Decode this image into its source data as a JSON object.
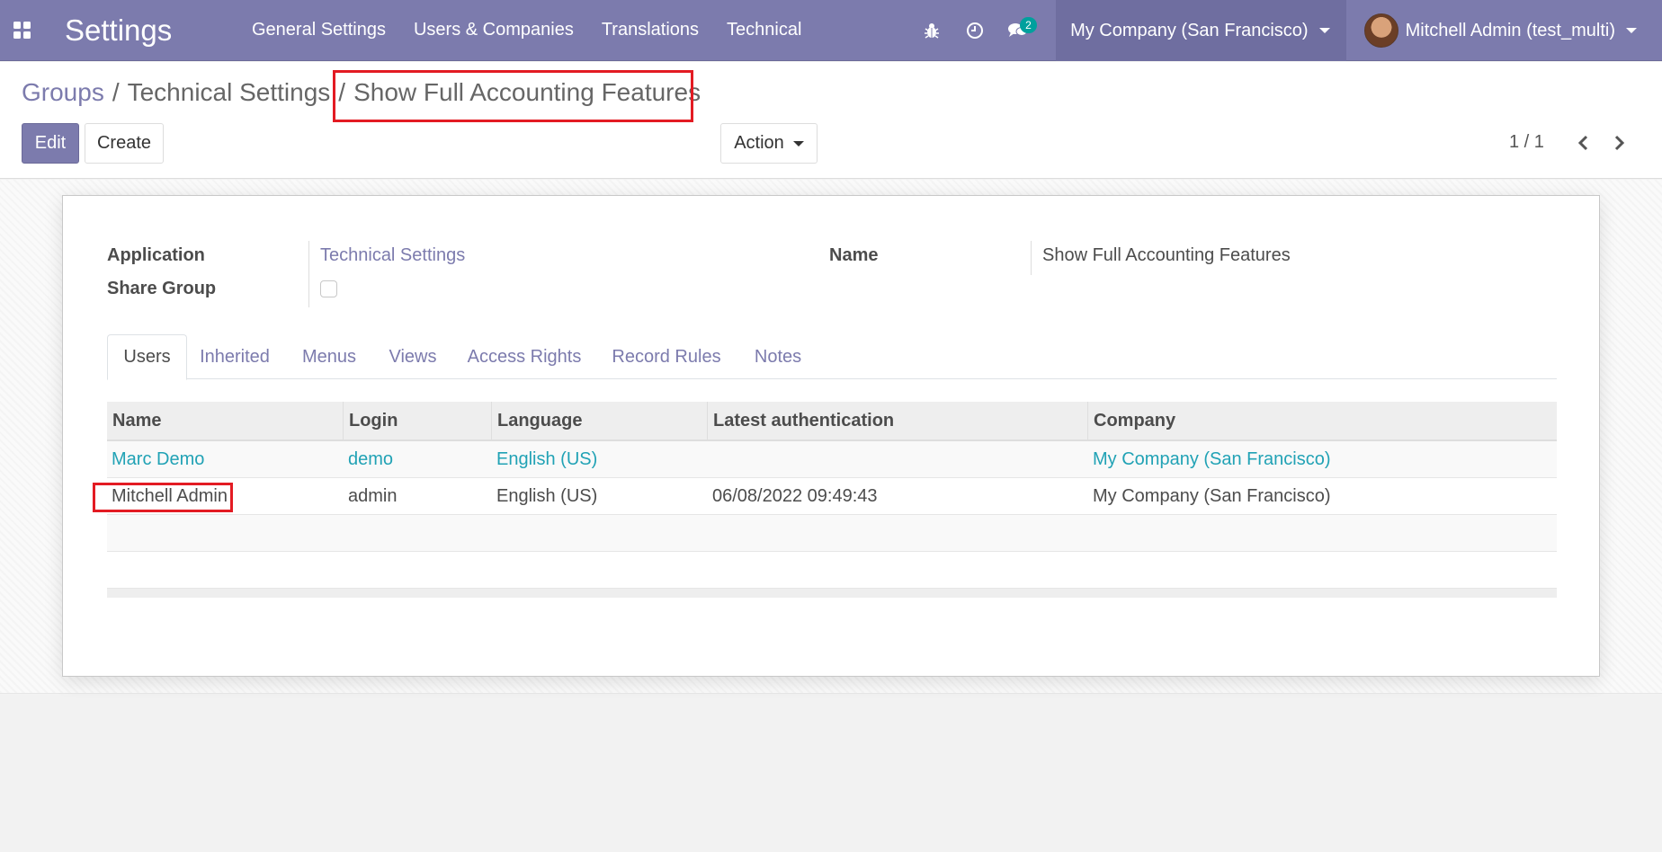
{
  "navbar": {
    "app_title": "Settings",
    "menu": [
      "General Settings",
      "Users & Companies",
      "Translations",
      "Technical"
    ],
    "icons": [
      "bug-icon",
      "clock-icon",
      "chat-icon"
    ],
    "chat_badge": "2",
    "company": "My Company (San Francisco)",
    "user": "Mitchell Admin (test_multi)",
    "color": "#7c7bad"
  },
  "breadcrumb": {
    "root": "Groups",
    "parent": "Technical Settings",
    "current": "Show Full Accounting Features"
  },
  "toolbar": {
    "edit_label": "Edit",
    "create_label": "Create",
    "action_label": "Action",
    "pager": "1 / 1"
  },
  "form": {
    "application_label": "Application",
    "application_value": "Technical Settings",
    "share_group_label": "Share Group",
    "share_group_checked": false,
    "name_label": "Name",
    "name_value": "Show Full Accounting Features"
  },
  "tabs": [
    "Users",
    "Inherited",
    "Menus",
    "Views",
    "Access Rights",
    "Record Rules",
    "Notes"
  ],
  "active_tab": "Users",
  "users_table": {
    "columns": [
      "Name",
      "Login",
      "Language",
      "Latest authentication",
      "Company"
    ],
    "rows": [
      [
        "Marc Demo",
        "demo",
        "English (US)",
        "",
        "My Company (San Francisco)"
      ],
      [
        "Mitchell Admin",
        "admin",
        "English (US)",
        "06/08/2022 09:49:43",
        "My Company (San Francisco)"
      ]
    ]
  }
}
